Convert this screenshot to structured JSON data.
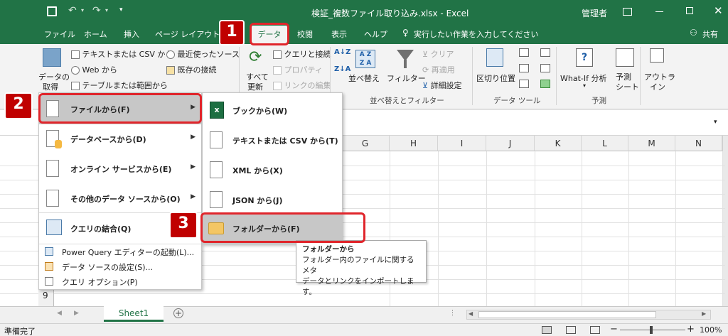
{
  "title_bar": {
    "filename": "検証_複数ファイル取り込み.xlsx - Excel",
    "user": "管理者"
  },
  "tabs": [
    "ファイル",
    "ホーム",
    "挿入",
    "ページ レイアウト",
    "データ",
    "校閲",
    "表示",
    "ヘルプ"
  ],
  "tell_me": "実行したい作業を入力してください",
  "share": "共有",
  "ribbon": {
    "get_data": "データの取得",
    "get_data_l1": "データの",
    "get_data_l2": "取得",
    "from_text_csv": "テキストまたは CSV から",
    "from_web": "Web から",
    "from_table": "テーブルまたは範囲から",
    "recent_sources": "最近使ったソース",
    "existing_conn": "既存の接続",
    "refresh_l1": "すべて",
    "refresh_l2": "更新",
    "queries_conn": "クエリと接続",
    "properties": "プロパティ",
    "edit_links": "リンクの編集",
    "sort": "並べ替え",
    "filter": "フィルター",
    "clear": "クリア",
    "reapply": "再適用",
    "advanced": "詳細設定",
    "sort_filter_group": "並べ替えとフィルター",
    "text_to_columns": "区切り位置",
    "data_tools_group": "データ ツール",
    "whatif": "What-If 分析",
    "forecast_l1": "予測",
    "forecast_l2": "シート",
    "forecast_group": "予測",
    "outline_l1": "アウトラ",
    "outline_l2": "イン"
  },
  "columns": [
    "G",
    "H",
    "I",
    "J",
    "K",
    "L",
    "M",
    "N"
  ],
  "visible_row": "9",
  "menu_main": {
    "from_file": "ファイルから(F)",
    "from_database": "データベースから(D)",
    "from_online": "オンライン サービスから(E)",
    "from_other": "その他のデータ ソースから(O)",
    "combine": "クエリの結合(Q)",
    "pq_editor": "Power Query エディターの起動(L)...",
    "data_source_settings": "データ ソースの設定(S)...",
    "query_options": "クエリ オプション(P)"
  },
  "menu_sub": {
    "from_workbook": "ブックから(W)",
    "from_text": "テキストまたは CSV から(T)",
    "from_xml": "XML から(X)",
    "from_json": "JSON から(J)",
    "from_folder": "フォルダーから(F)"
  },
  "tooltip": {
    "title": "フォルダーから",
    "line1": "フォルダー内のファイルに関するメタ",
    "line2": "データとリンクをインポートします。"
  },
  "callouts": [
    "1",
    "2",
    "3"
  ],
  "sheet_tab": "Sheet1",
  "status": {
    "ready": "準備完了",
    "zoom": "100%"
  },
  "colors": {
    "excel_green": "#217346",
    "callout_red": "#c00000",
    "highlight_red": "#e0252b"
  }
}
